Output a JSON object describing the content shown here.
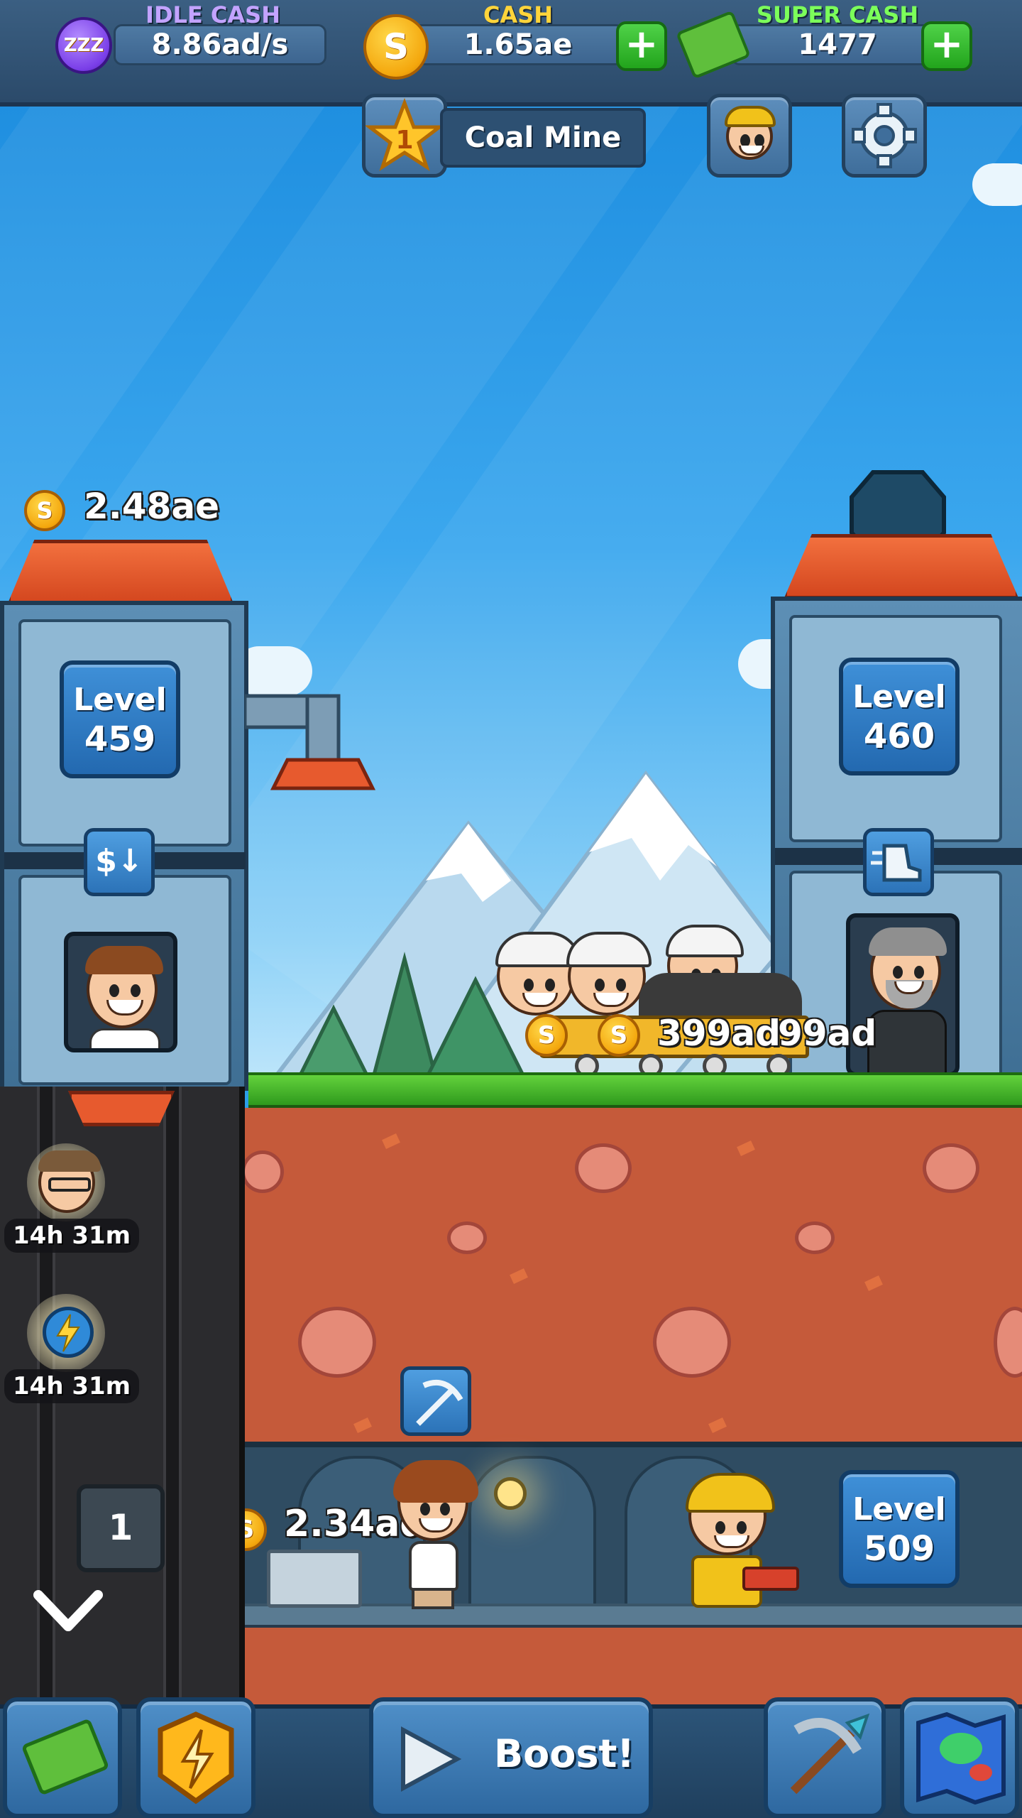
{
  "hud": {
    "idle_cash_label": "IDLE CASH",
    "idle_cash_value": "8.86ad/s",
    "cash_label": "CASH",
    "cash_value": "1.65ae",
    "super_cash_label": "SUPER CASH",
    "super_cash_value": "1477",
    "plus_glyph": "+",
    "coin_glyph": "S"
  },
  "mine": {
    "star_number": "1",
    "name": "Coal Mine"
  },
  "warehouse": {
    "stored_cash": "2.48ae",
    "level_label": "Level",
    "level_value": "459",
    "sell_button_glyph": "$↓"
  },
  "elevator_tower": {
    "level_label": "Level",
    "level_value": "460"
  },
  "transport": {
    "cart_value": "399ad",
    "cart_value_overlap": "99ad"
  },
  "shaft": {
    "stored_cash": "2.34ad",
    "level_label": "Level",
    "level_value": "509",
    "shaft_number": "1"
  },
  "boosts": {
    "manager_timer": "14h 31m",
    "ability_timer": "14h 31m"
  },
  "bottom_bar": {
    "boost_label": "Boost!"
  },
  "icons": [
    "zzz-idle-icon",
    "coin-icon",
    "cash-stack-icon",
    "star-icon",
    "miner-profile-icon",
    "gear-icon",
    "pickaxe-icon",
    "chevron-down-icon",
    "play-icon",
    "shield-bolt-icon",
    "world-map-icon"
  ],
  "colors": {
    "idle_label": "#c3a3ff",
    "cash_label": "#ffd43a",
    "super_cash_label": "#7cff5a",
    "plus_green": "#22a41c",
    "roof_orange": "#e05a2c",
    "dirt": "#c55a3a",
    "grass": "#4fbf2e"
  }
}
